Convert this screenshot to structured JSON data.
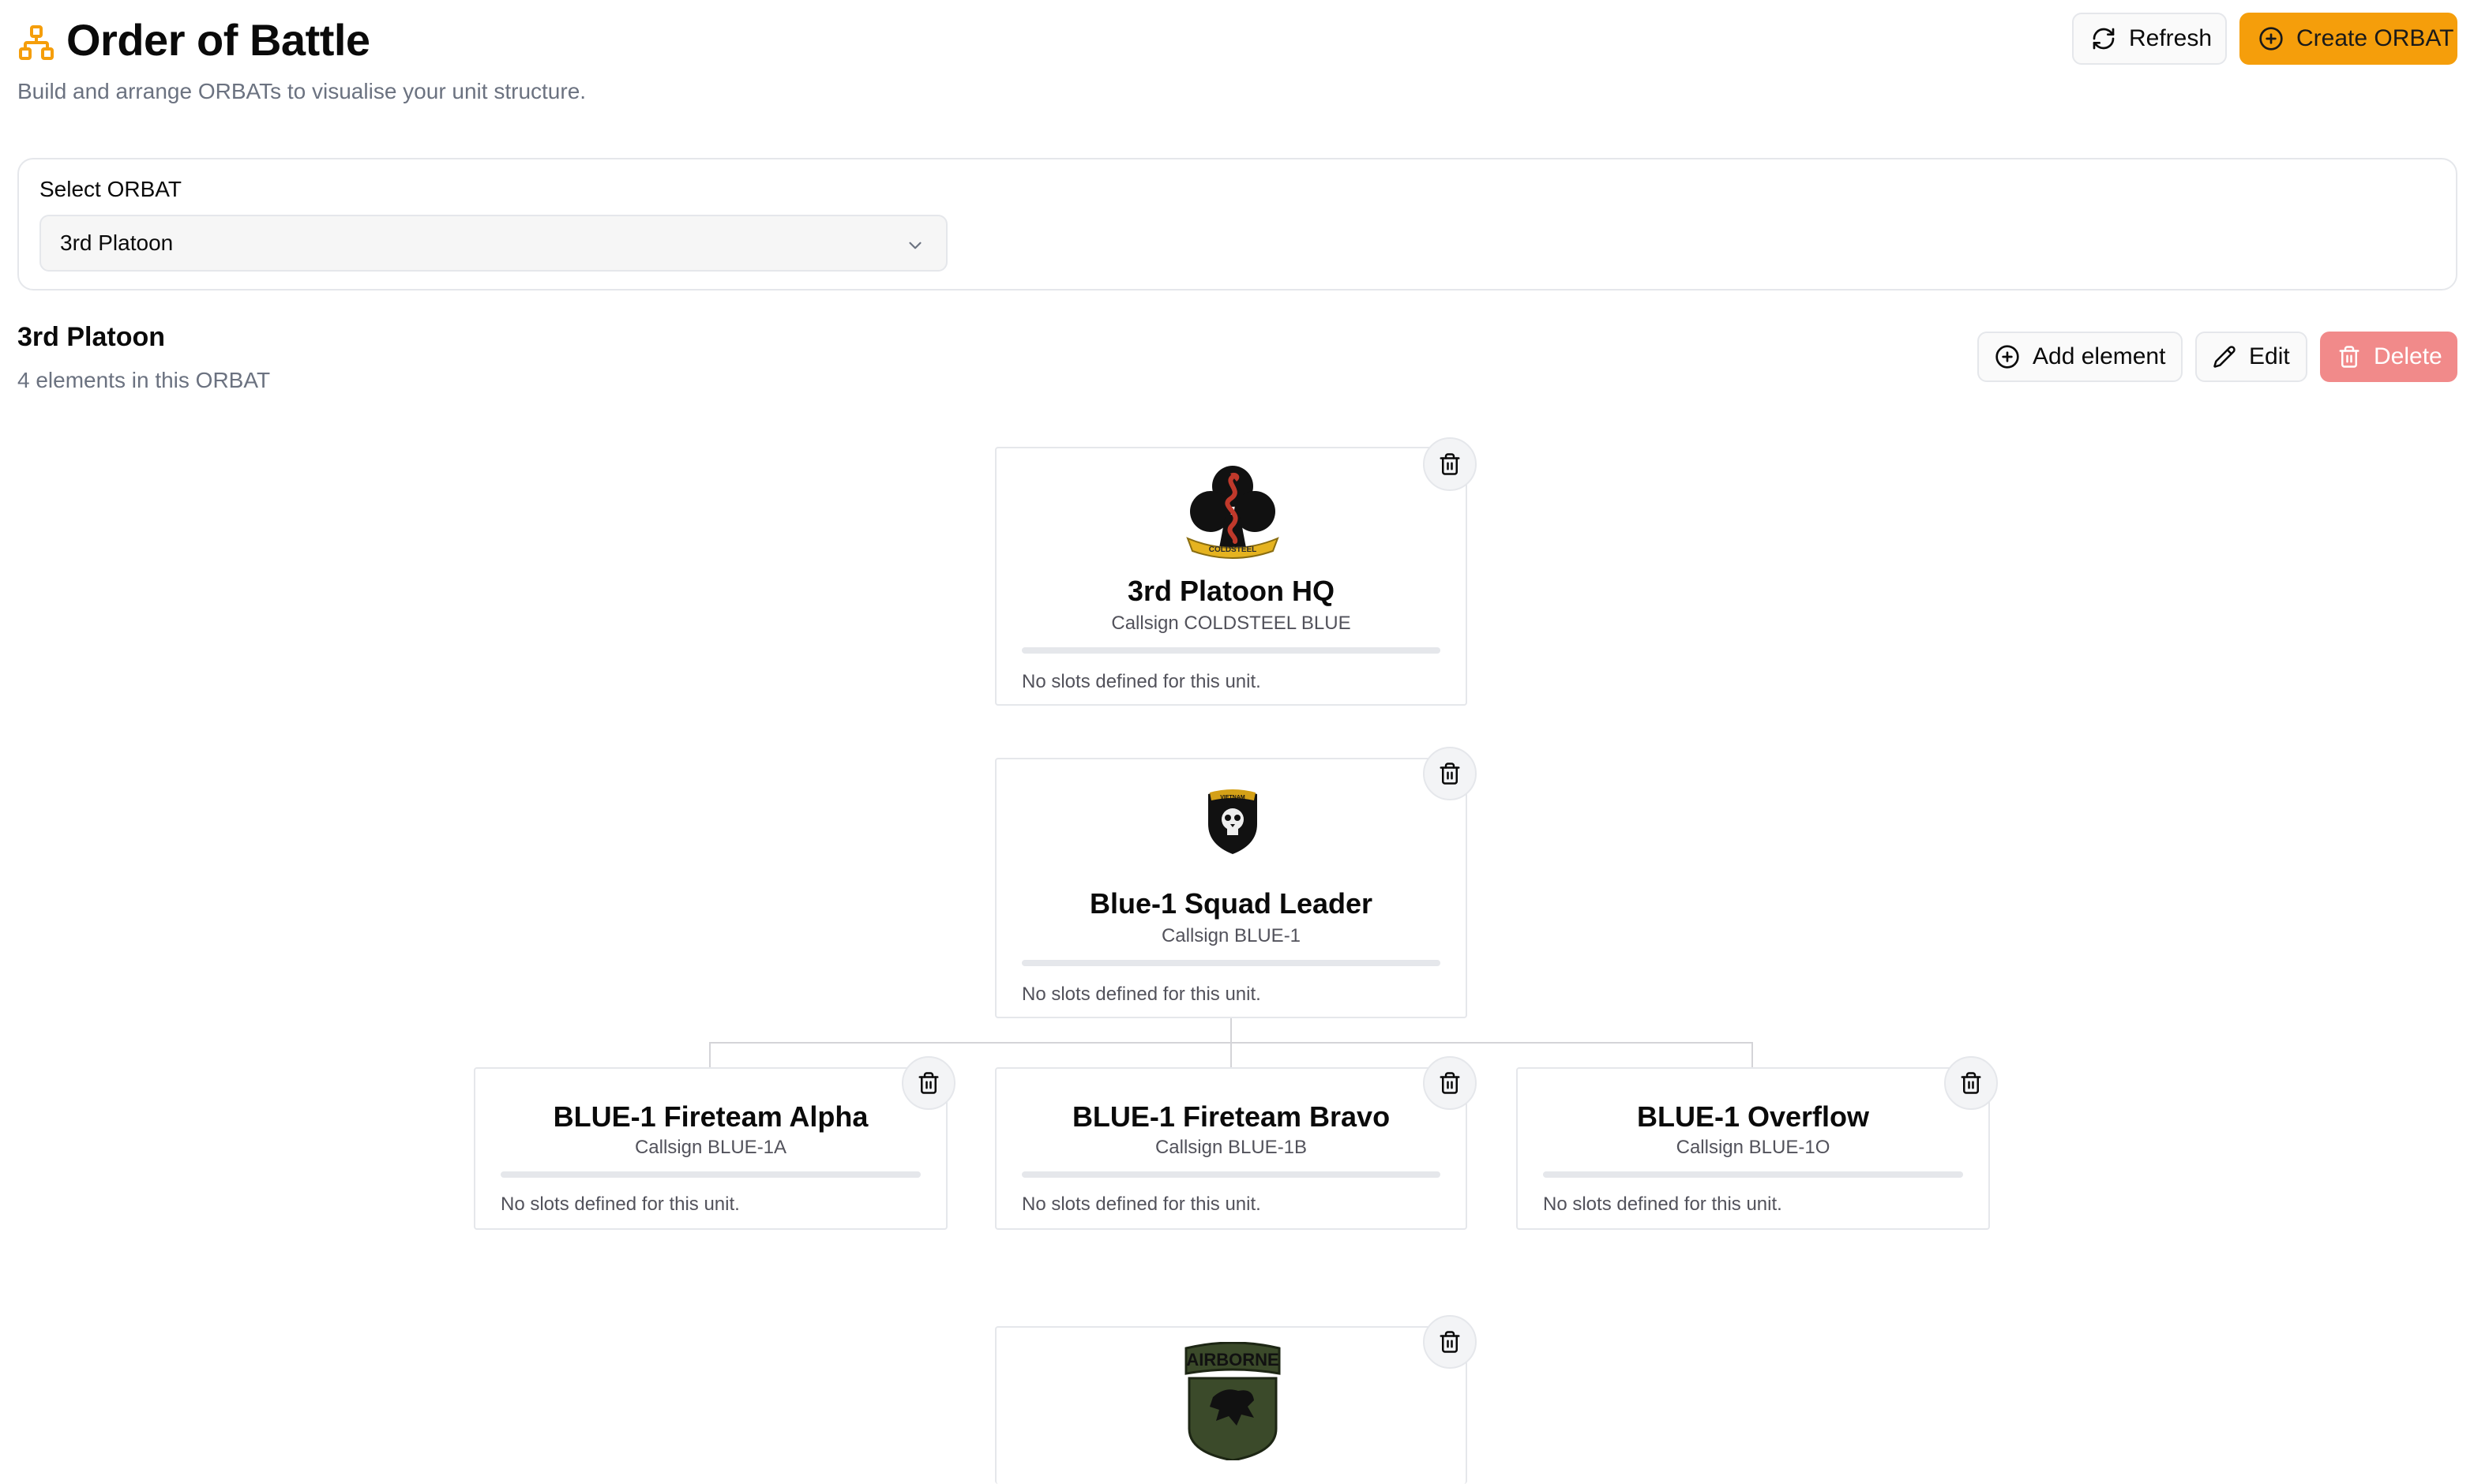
{
  "header": {
    "title": "Order of Battle",
    "subtitle": "Build and arrange ORBATs to visualise your unit structure.",
    "title_icon": "sitemap-icon",
    "refresh_label": "Refresh",
    "create_label": "Create ORBAT"
  },
  "selector": {
    "label": "Select ORBAT",
    "value": "3rd Platoon"
  },
  "orbat": {
    "name": "3rd Platoon",
    "count_text": "4 elements in this ORBAT",
    "add_label": "Add element",
    "edit_label": "Edit",
    "delete_label": "Delete"
  },
  "units": [
    {
      "name": "3rd Platoon HQ",
      "callsign": "Callsign COLDSTEEL BLUE",
      "slots": "No slots defined for this unit.",
      "emblem": "cobra-club-emblem",
      "emblem_text": "COLDSTEEL"
    },
    {
      "name": "Blue-1 Squad Leader",
      "callsign": "Callsign BLUE-1",
      "slots": "No slots defined for this unit.",
      "emblem": "skull-shield-emblem",
      "emblem_text": "VIETNAM"
    },
    {
      "name": "BLUE-1 Fireteam Alpha",
      "callsign": "Callsign BLUE-1A",
      "slots": "No slots defined for this unit."
    },
    {
      "name": "BLUE-1 Fireteam Bravo",
      "callsign": "Callsign BLUE-1B",
      "slots": "No slots defined for this unit."
    },
    {
      "name": "BLUE-1 Overflow",
      "callsign": "Callsign BLUE-1O",
      "slots": "No slots defined for this unit."
    },
    {
      "emblem": "airborne-lion-emblem",
      "emblem_text": "AIRBORNE"
    }
  ],
  "colors": {
    "accent": "#f59e0b",
    "danger": "#f18a8a",
    "muted_text": "#6b7280",
    "border": "#e5e7eb"
  }
}
